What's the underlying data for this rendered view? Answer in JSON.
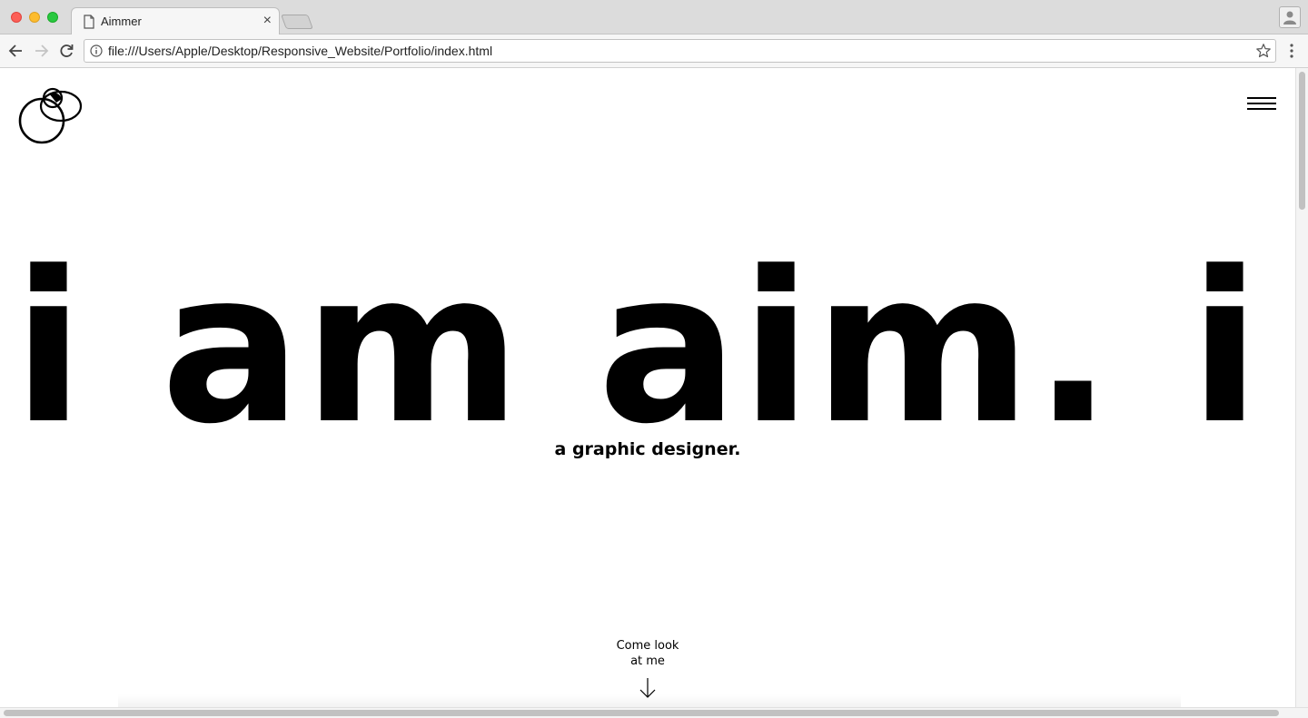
{
  "browser": {
    "tab_title": "Aimmer",
    "tab_close": "×",
    "url": "file:///Users/Apple/Desktop/Responsive_Website/Portfolio/index.html"
  },
  "icons": {
    "tab": "document-icon",
    "back": "arrow-left-icon",
    "forward": "arrow-right-icon",
    "reload": "reload-icon",
    "info": "info-icon",
    "bookmark": "star-icon",
    "menu": "vertical-dots-icon",
    "profile": "person-icon",
    "logo": "overlapping-circles-logo",
    "page_menu": "hamburger-icon",
    "scroll_hint": "arrow-down-icon"
  },
  "page": {
    "hero_text": "i am aim. i am aim.",
    "subtitle": "a graphic designer.",
    "cta_line1": "Come look",
    "cta_line2": "at me"
  }
}
